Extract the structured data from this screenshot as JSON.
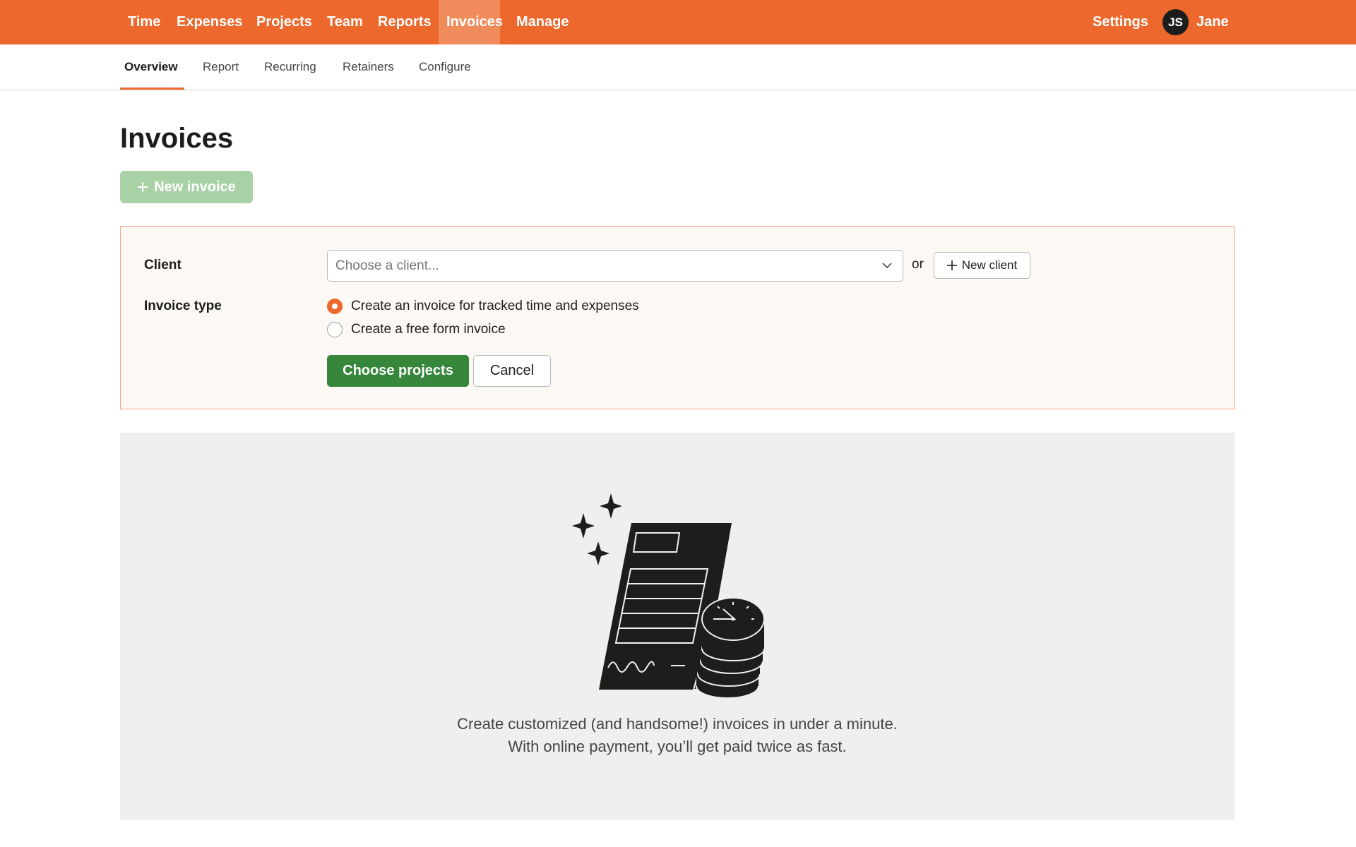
{
  "topnav": {
    "items": [
      {
        "label": "Time"
      },
      {
        "label": "Expenses"
      },
      {
        "label": "Projects"
      },
      {
        "label": "Team"
      },
      {
        "label": "Reports"
      },
      {
        "label": "Invoices",
        "active": true
      },
      {
        "label": "Manage"
      }
    ],
    "settings_label": "Settings",
    "avatar_initials": "JS",
    "user_name": "Jane",
    "colors": {
      "bar": "#ec682c",
      "active": "#f08b5c"
    }
  },
  "subnav": {
    "items": [
      {
        "label": "Overview",
        "active": true
      },
      {
        "label": "Report"
      },
      {
        "label": "Recurring"
      },
      {
        "label": "Retainers"
      },
      {
        "label": "Configure"
      }
    ]
  },
  "page": {
    "title": "Invoices",
    "new_invoice_label": "New invoice"
  },
  "form": {
    "client_label": "Client",
    "client_placeholder": "Choose a client...",
    "or_text": "or",
    "new_client_label": "New client",
    "invoice_type_label": "Invoice type",
    "options": [
      {
        "label": "Create an invoice for tracked time and expenses",
        "checked": true
      },
      {
        "label": "Create a free form invoice",
        "checked": false
      }
    ],
    "choose_projects_label": "Choose projects",
    "cancel_label": "Cancel",
    "colors": {
      "primary": "#36863b",
      "accent": "#ec682c",
      "panel_bg": "#fcf8f3"
    }
  },
  "empty_state": {
    "line1": "Create customized (and handsome!) invoices in under a minute.",
    "line2": "With online payment, you’ll get paid twice as fast.",
    "illustration": "invoice-with-clock-coins-illustration"
  }
}
